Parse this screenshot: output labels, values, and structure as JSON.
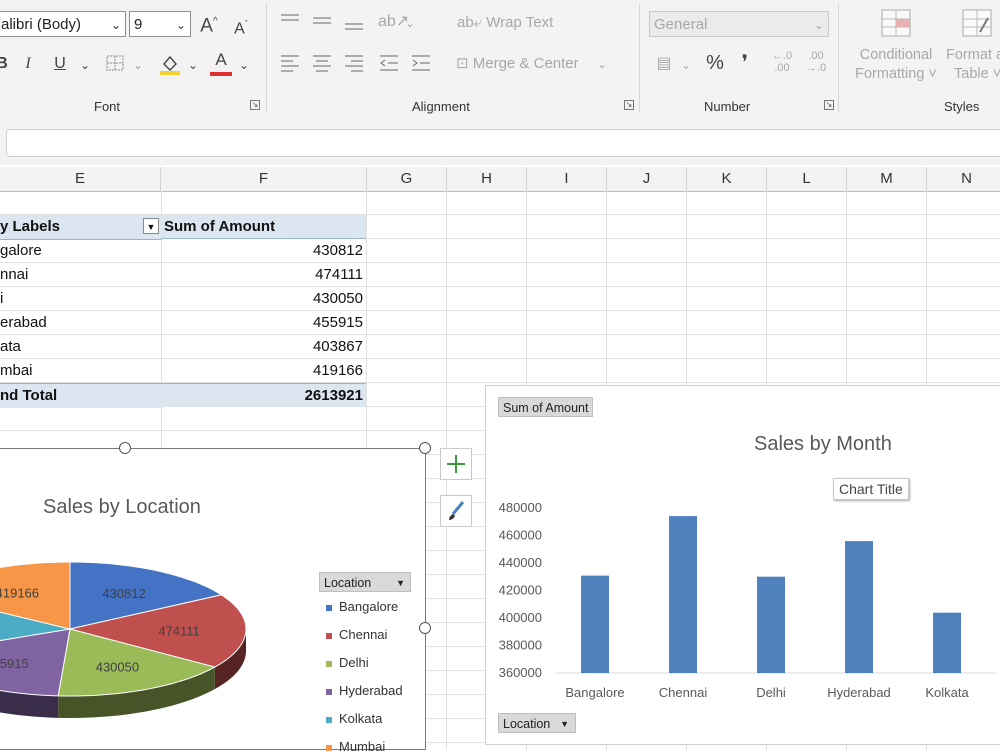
{
  "ribbon": {
    "font_name": "alibri (Body)",
    "font_size": "9",
    "grow_font": "A^",
    "shrink_font": "A˅",
    "bold": "B",
    "italic": "I",
    "underline": "U",
    "font_color_letter": "A",
    "wrap_text": "Wrap Text",
    "merge_center": "Merge & Center",
    "number_format": "General",
    "percent": "%",
    "comma": "❜",
    "increase_decimal": "←.0 .00",
    "decrease_decimal": ".00 →.0",
    "conditional_formatting": [
      "Conditional",
      "Formatting ˅"
    ],
    "format_as_table": [
      "Format a",
      "Table ˅"
    ],
    "groups": {
      "font": "Font",
      "alignment": "Alignment",
      "number": "Number",
      "styles": "Styles"
    },
    "colors": {
      "fill_color": "#f4d030",
      "font_color": "#e03030"
    }
  },
  "columns": [
    "E",
    "F",
    "G",
    "H",
    "I",
    "J",
    "K",
    "L",
    "M",
    "N"
  ],
  "pivot": {
    "header_labels": "y Labels",
    "header_sum": "Sum of Amount",
    "rows": [
      {
        "label": "galore",
        "value": "430812"
      },
      {
        "label": "nnai",
        "value": "474111"
      },
      {
        "label": "i",
        "value": "430050"
      },
      {
        "label": "erabad",
        "value": "455915"
      },
      {
        "label": "ata",
        "value": "403867"
      },
      {
        "label": "mbai",
        "value": "419166"
      }
    ],
    "total_label": "nd Total",
    "total_value": "2613921"
  },
  "pie_chart": {
    "title": "Sales by Location",
    "legend_button": "Location",
    "legend": [
      "Bangalore",
      "Chennai",
      "Delhi",
      "Hyderabad",
      "Kolkata",
      "Mumbai"
    ],
    "side_buttons": [
      "plus-icon",
      "brush-icon"
    ]
  },
  "bar_chart": {
    "field_button_top": "Sum of Amount",
    "field_button_bottom": "Location",
    "tooltip": "Chart Title"
  },
  "chart_data": [
    {
      "type": "pie",
      "title": "Sales by Location",
      "categories": [
        "Bangalore",
        "Chennai",
        "Delhi",
        "Hyderabad",
        "Kolkata",
        "Mumbai"
      ],
      "values": [
        430812,
        474111,
        430050,
        455915,
        403867,
        419166
      ],
      "colors": [
        "#4472c4",
        "#c0504d",
        "#9bbb59",
        "#8064a2",
        "#4bacc6",
        "#f79646"
      ],
      "data_labels_visible": [
        "430812",
        "474111",
        "430050",
        "419166"
      ],
      "legend_title": "Location",
      "legend_position": "right"
    },
    {
      "type": "bar",
      "title": "Sales by Month",
      "categories": [
        "Bangalore",
        "Chennai",
        "Delhi",
        "Hyderabad",
        "Kolkata"
      ],
      "values": [
        430812,
        474111,
        430050,
        455915,
        403867
      ],
      "ylim": [
        360000,
        480000
      ],
      "yticks": [
        "360000",
        "380000",
        "400000",
        "420000",
        "440000",
        "460000",
        "480000"
      ],
      "color": "#4f81bd",
      "grid": false
    }
  ]
}
